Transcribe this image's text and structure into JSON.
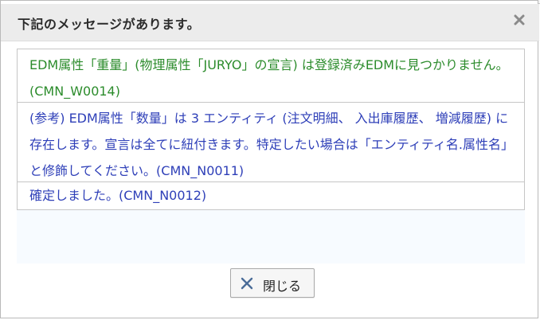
{
  "dialog": {
    "title": "下記のメッセージがあります。",
    "close_icon": "close-icon",
    "messages": [
      {
        "type": "warning",
        "text": "EDM属性「重量」(物理属性「JURYO」の宣言) は登録済みEDMに見つかりません。(CMN_W0014)"
      },
      {
        "type": "info",
        "text": "(参考) EDM属性「数量」は 3 エンティティ (注文明細、 入出庫履歴、 増減履歴) に存在します。宣言は全てに紐付きます。特定したい場合は「エンティティ名.属性名」と修飾してください。(CMN_N0011)"
      },
      {
        "type": "info",
        "text": "確定しました。(CMN_N0012)"
      }
    ],
    "close_button": {
      "label": "閉じる",
      "icon": "x-icon"
    }
  },
  "colors": {
    "warning_text": "#2c8c2c",
    "info_text": "#2e3fb8",
    "close_x_icon": "#4a6c98",
    "titlebar_bg": "#ececec"
  }
}
